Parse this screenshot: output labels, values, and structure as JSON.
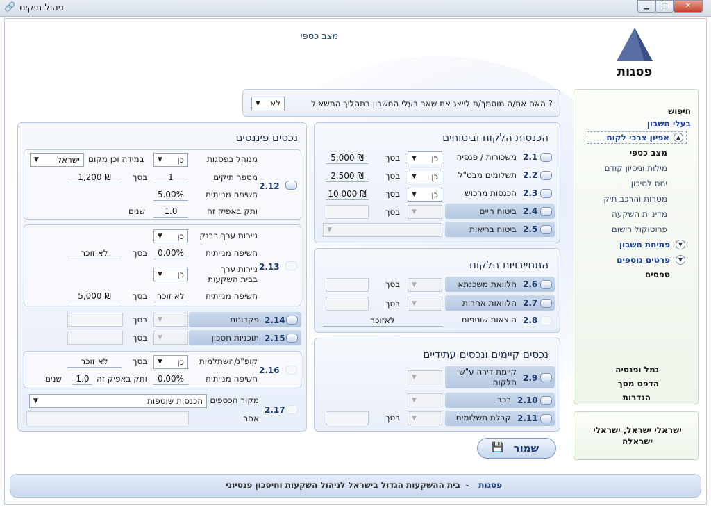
{
  "window": {
    "title": "ניהול תיקים",
    "min": "▁",
    "max": "▢",
    "close": "✕"
  },
  "header": {
    "page_title": "מצב כספי",
    "logo_text": "פסגות"
  },
  "question": {
    "text": "האם את/ה מוסמך/ת לייצג את שאר בעלי החשבון בתהליך התשאול ?",
    "answer": "לא"
  },
  "sidebar": {
    "search": "חיפוש",
    "account_holders": "בעלי חשבון",
    "needs": "אפיון צרכי לקוח",
    "items": [
      "מצב כספי",
      "מילות וניסיון קודם",
      "יחס לסיכון",
      "מטרות והרכב תיק",
      "מדיניות השקעה",
      "פרוטוקול רישום"
    ],
    "open_account": "פתיחת חשבון",
    "more_details": "פרטים נוספים",
    "forms": "טפסים",
    "pension": "גמל ופנסיה",
    "print_doc": "הדפס מסך",
    "settings": "הגדרות",
    "clients": "ישראלי ישראל, ישראלי ישראלה"
  },
  "income": {
    "title": "הכנסות הלקוח וביטוחים",
    "rows": [
      {
        "num": "2.1",
        "label": "משכורות / פנסיה",
        "yn": "כן",
        "sum_label": "בסך",
        "value": "5,000 ₪"
      },
      {
        "num": "2.2",
        "label": "תשלומים מבט\"ל",
        "yn": "כן",
        "sum_label": "בסך",
        "value": "2,500 ₪"
      },
      {
        "num": "2.3",
        "label": "הכנסות מרכוש",
        "yn": "כן",
        "sum_label": "בסך",
        "value": "10,000 ₪"
      },
      {
        "num": "2.4",
        "label": "ביטוח חיים",
        "sum_label": "בסך"
      },
      {
        "num": "2.5",
        "label": "ביטוח בריאות"
      }
    ]
  },
  "obligations": {
    "title": "התחייבויות הלקוח",
    "rows": [
      {
        "num": "2.6",
        "label": "הלוואת משכנתא",
        "sum_label": "בסך"
      },
      {
        "num": "2.7",
        "label": "הלוואות אחרות",
        "sum_label": "בסך"
      },
      {
        "num": "2.8",
        "label": "הוצאות שוטפות",
        "value": "לאזוכר"
      }
    ]
  },
  "assets": {
    "title": "נכסים קיימים ונכסים עתידיים",
    "rows": [
      {
        "num": "2.9",
        "label": "קיימת דירה ע\"ש הלקוח"
      },
      {
        "num": "2.10",
        "label": "רכב"
      },
      {
        "num": "2.11",
        "label": "קבלת תשלומים",
        "sum_label": "בסך"
      }
    ]
  },
  "financial": {
    "title": "נכסים פיננסים",
    "r212": {
      "num": "2.12",
      "managed": "מנוהל בפסגות",
      "managed_yn": "כן",
      "where": "במידה וכן מקום",
      "where_val": "ישראל",
      "portfolios": "מספר תיקים",
      "portfolios_val": "1",
      "sum_label": "בסך",
      "sum_val": "1,200 ₪",
      "exposure": "חשיפה מנייתית",
      "exposure_val": "5.00%",
      "horizon": "ותק באפיק זה",
      "horizon_val": "1.0",
      "years": "שנים"
    },
    "r213": {
      "num": "2.13",
      "bank_sec": "ניירות ערך בבנק",
      "bank_yn": "כן",
      "exposure": "חשיפה מנייתית",
      "exp1": "0.00%",
      "sum_label": "בסך",
      "sum1": "לא זוכר",
      "broker_sec": "ניירות ערך בבית השקעות",
      "broker_yn": "כן",
      "exp2": "לא זוכר",
      "sum2": "5,000 ₪"
    },
    "r214": {
      "num": "2.14",
      "label": "פקדונות",
      "sum_label": "בסך"
    },
    "r215": {
      "num": "2.15",
      "label": "תוכניות חסכון",
      "sum_label": "בסך"
    },
    "r216": {
      "num": "2.16",
      "label": "קופ\"ג/השתלמות",
      "yn": "כן",
      "sum_label": "בסך",
      "sum_val": "לא זוכר",
      "exposure": "חשיפה מנייתית",
      "exp_val": "0.00%",
      "horizon": "ותק באפיק זה",
      "horizon_val": "1.0",
      "years": "שנים"
    },
    "r217": {
      "num": "2.17",
      "label": "מקור הכספים",
      "value": "הכנסות שוטפות",
      "other": "אחר"
    }
  },
  "save": {
    "label": "שמור",
    "icon": "💾"
  },
  "footer": {
    "brand": "פסגות",
    "dash": "-",
    "text": "בית ההשקעות הגדול בישראל לניהול השקעות וחיסכון פנסיוני"
  }
}
